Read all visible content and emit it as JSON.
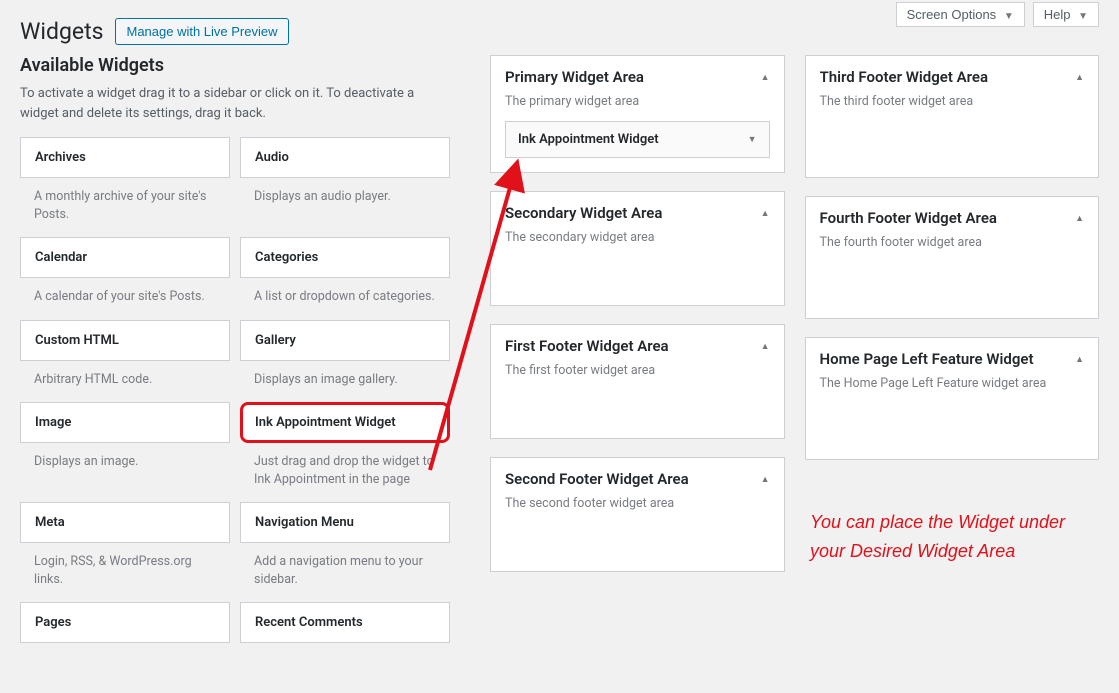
{
  "topButtons": {
    "screenOptions": "Screen Options",
    "help": "Help"
  },
  "header": {
    "title": "Widgets",
    "manageBtn": "Manage with Live Preview"
  },
  "available": {
    "heading": "Available Widgets",
    "intro": "To activate a widget drag it to a sidebar or click on it. To deactivate a widget and delete its settings, drag it back.",
    "widgets": [
      {
        "name": "Archives",
        "desc": "A monthly archive of your site's Posts."
      },
      {
        "name": "Audio",
        "desc": "Displays an audio player."
      },
      {
        "name": "Calendar",
        "desc": "A calendar of your site's Posts."
      },
      {
        "name": "Categories",
        "desc": "A list or dropdown of categories."
      },
      {
        "name": "Custom HTML",
        "desc": "Arbitrary HTML code."
      },
      {
        "name": "Gallery",
        "desc": "Displays an image gallery."
      },
      {
        "name": "Image",
        "desc": "Displays an image."
      },
      {
        "name": "Ink Appointment Widget",
        "desc": "Just drag and drop the widget to Ink Appointment in the page",
        "highlight": true
      },
      {
        "name": "Meta",
        "desc": "Login, RSS, & WordPress.org links."
      },
      {
        "name": "Navigation Menu",
        "desc": "Add a navigation menu to your sidebar."
      },
      {
        "name": "Pages",
        "desc": ""
      },
      {
        "name": "Recent Comments",
        "desc": ""
      }
    ]
  },
  "areasLeft": [
    {
      "title": "Primary Widget Area",
      "desc": "The primary widget area",
      "placed": "Ink Appointment Widget"
    },
    {
      "title": "Secondary Widget Area",
      "desc": "The secondary widget area"
    },
    {
      "title": "First Footer Widget Area",
      "desc": "The first footer widget area"
    },
    {
      "title": "Second Footer Widget Area",
      "desc": "The second footer widget area"
    }
  ],
  "areasRight": [
    {
      "title": "Third Footer Widget Area",
      "desc": "The third footer widget area"
    },
    {
      "title": "Fourth Footer Widget Area",
      "desc": "The fourth footer widget area"
    },
    {
      "title": "Home Page Left Feature Widget",
      "desc": "The Home Page Left Feature widget area"
    }
  ],
  "annotation": "You can place the Widget under your Desired Widget Area"
}
